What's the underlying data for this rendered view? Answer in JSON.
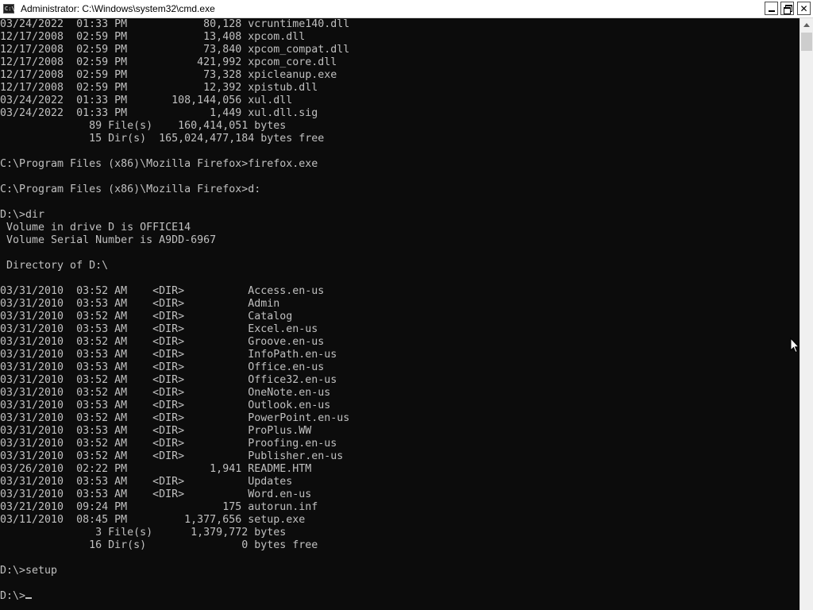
{
  "window": {
    "title": "Administrator: C:\\Windows\\system32\\cmd.exe",
    "icon_label": "C:\\"
  },
  "console": {
    "lines": [
      "03/24/2022  01:33 PM            80,128 vcruntime140.dll",
      "12/17/2008  02:59 PM            13,408 xpcom.dll",
      "12/17/2008  02:59 PM            73,840 xpcom_compat.dll",
      "12/17/2008  02:59 PM           421,992 xpcom_core.dll",
      "12/17/2008  02:59 PM            73,328 xpicleanup.exe",
      "12/17/2008  02:59 PM            12,392 xpistub.dll",
      "03/24/2022  01:33 PM       108,144,056 xul.dll",
      "03/24/2022  01:33 PM             1,449 xul.dll.sig",
      "              89 File(s)    160,414,051 bytes",
      "              15 Dir(s)  165,024,477,184 bytes free",
      "",
      "C:\\Program Files (x86)\\Mozilla Firefox>firefox.exe",
      "",
      "C:\\Program Files (x86)\\Mozilla Firefox>d:",
      "",
      "D:\\>dir",
      " Volume in drive D is OFFICE14",
      " Volume Serial Number is A9DD-6967",
      "",
      " Directory of D:\\",
      "",
      "03/31/2010  03:52 AM    <DIR>          Access.en-us",
      "03/31/2010  03:53 AM    <DIR>          Admin",
      "03/31/2010  03:52 AM    <DIR>          Catalog",
      "03/31/2010  03:53 AM    <DIR>          Excel.en-us",
      "03/31/2010  03:52 AM    <DIR>          Groove.en-us",
      "03/31/2010  03:53 AM    <DIR>          InfoPath.en-us",
      "03/31/2010  03:53 AM    <DIR>          Office.en-us",
      "03/31/2010  03:52 AM    <DIR>          Office32.en-us",
      "03/31/2010  03:52 AM    <DIR>          OneNote.en-us",
      "03/31/2010  03:53 AM    <DIR>          Outlook.en-us",
      "03/31/2010  03:52 AM    <DIR>          PowerPoint.en-us",
      "03/31/2010  03:53 AM    <DIR>          ProPlus.WW",
      "03/31/2010  03:52 AM    <DIR>          Proofing.en-us",
      "03/31/2010  03:52 AM    <DIR>          Publisher.en-us",
      "03/26/2010  02:22 PM             1,941 README.HTM",
      "03/31/2010  03:53 AM    <DIR>          Updates",
      "03/31/2010  03:53 AM    <DIR>          Word.en-us",
      "03/21/2010  09:24 PM               175 autorun.inf",
      "03/11/2010  08:45 PM         1,377,656 setup.exe",
      "               3 File(s)      1,379,772 bytes",
      "              16 Dir(s)               0 bytes free",
      "",
      "D:\\>setup",
      "",
      "D:\\>"
    ]
  },
  "colors": {
    "console_bg": "#0c0c0c",
    "console_fg": "#c0c0c0",
    "titlebar_bg": "#ffffff"
  },
  "icons": {
    "minimize": "minimize-icon",
    "maximize": "restore-icon",
    "close": "close-icon",
    "scroll_up": "arrow-up-icon",
    "pointer": "mouse-pointer-icon"
  }
}
